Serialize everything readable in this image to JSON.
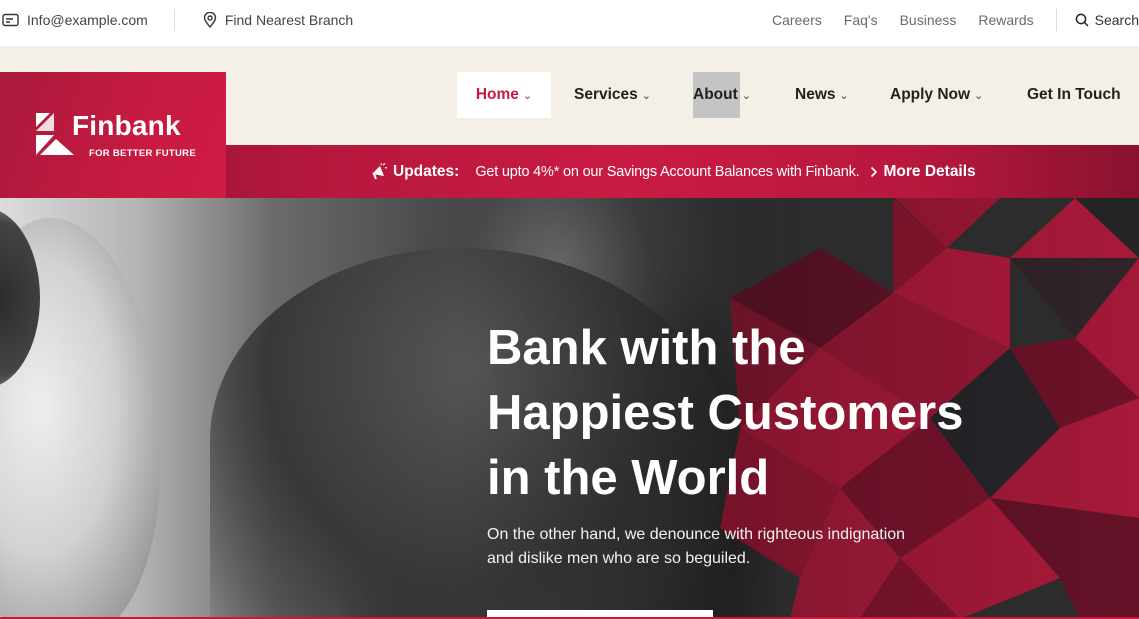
{
  "topbar": {
    "email": "Info@example.com",
    "branch": "Find Nearest Branch",
    "links": [
      "Careers",
      "Faq's",
      "Business",
      "Rewards"
    ],
    "search": "Search"
  },
  "logo": {
    "name": "Finbank",
    "tagline": "FOR BETTER FUTURE"
  },
  "nav": {
    "home": "Home",
    "services": "Services",
    "about": "About",
    "news": "News",
    "apply": "Apply Now",
    "touch": "Get In Touch"
  },
  "ribbon": {
    "label": "Updates:",
    "text": "Get upto 4%* on our Savings Account Balances with Finbank.",
    "more": "More Details"
  },
  "hero": {
    "title_lines": [
      "Bank with the",
      "Happiest Customers",
      "in the World"
    ],
    "sub_lines": [
      "On the other hand, we denounce with righteous indignation",
      "and dislike men who are so beguiled."
    ]
  },
  "colors": {
    "brand": "#c71a40",
    "brand_dark": "#8a1230",
    "header_bg": "#f4efe7"
  },
  "icons": {
    "email": "email-icon",
    "branch": "location-pin-icon",
    "search": "search-icon",
    "updates": "megaphone-icon",
    "more": "chevron-right-icon",
    "dropdown": "chevron-down-icon"
  }
}
